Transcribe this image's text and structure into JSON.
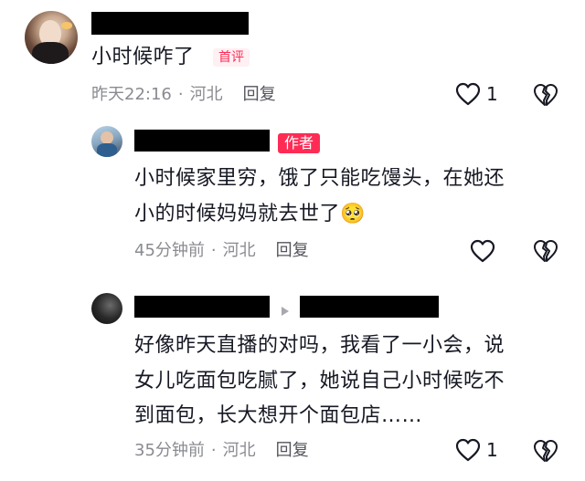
{
  "comments": [
    {
      "text_lines": [
        "小时候咋了"
      ],
      "badge": "首评",
      "time": "昨天22:16",
      "location": "河北",
      "reply_label": "回复",
      "like_count": "1"
    },
    {
      "text_lines": [
        "小时候家里穷，饿了只能吃馒头，在她还",
        "小的时候妈妈就去世了"
      ],
      "emoji": "🥺",
      "badge": "作者",
      "time": "45分钟前",
      "location": "河北",
      "reply_label": "回复",
      "like_count": ""
    },
    {
      "text_lines": [
        "好像昨天直播的对吗，我看了一小会，说",
        "女儿吃面包吃腻了，她说自己小时候吃不",
        "到面包，长大想开个面包店……"
      ],
      "time": "35分钟前",
      "location": "河北",
      "reply_label": "回复",
      "like_count": "1"
    }
  ],
  "meta_separator": "·",
  "colors": {
    "accent": "#fe2c55",
    "meta": "#8a8b91",
    "text": "#161823"
  }
}
